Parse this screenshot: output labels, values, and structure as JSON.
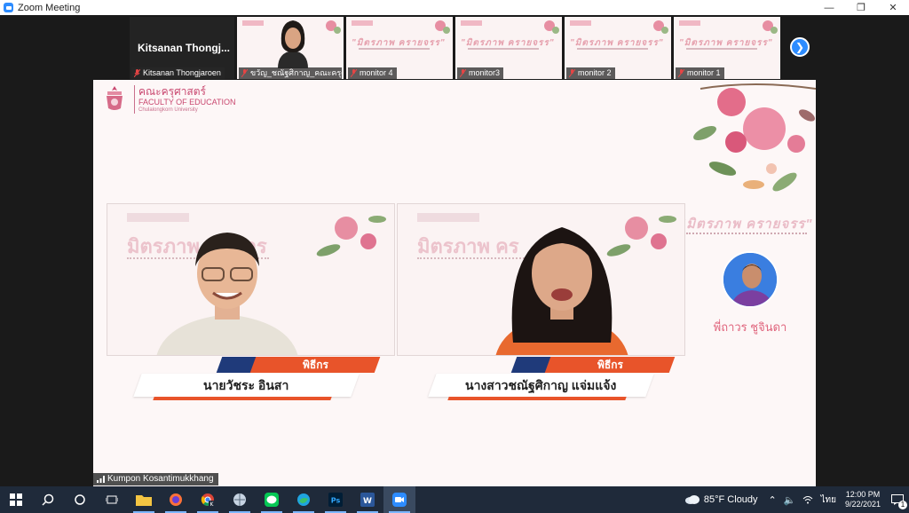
{
  "window": {
    "title": "Zoom Meeting"
  },
  "strip": {
    "self_big_name": "Kitsanan  Thongj...",
    "self_label": "Kitsanan Thongjaroen",
    "thumbs": [
      {
        "label": "ขวัญ_ชณัฐศิกาญ_คณะครุศาสตร์..."
      },
      {
        "label": "monitor 4"
      },
      {
        "label": "monitor3"
      },
      {
        "label": "monitor 2"
      },
      {
        "label": "monitor 1"
      }
    ],
    "thumb_slide_title": "\"มิตรภาพ ครายจรร\""
  },
  "slide": {
    "logo_th": "คณะครุศาสตร์",
    "logo_en": "FACULTY OF EDUCATION",
    "logo_sub": "Chulalongkorn University",
    "side_title": "\"มิตรภาพ ครายจรร\"",
    "side_name": "พี่ถาวร ชูจินดา",
    "pane_title_left": "มิตรภาพ ค...าวร",
    "pane_title_right": "มิตรภาพ คร",
    "speakers": [
      {
        "role": "พิธีกร",
        "name": "นายวัชระ อินสา"
      },
      {
        "role": "พิธีกร",
        "name": "นางสาวชณัฐศิกาญ แจ่มแจ้ง"
      }
    ]
  },
  "active_speaker": "Kumpon Kosantimukkhang",
  "tray": {
    "weather": "85°F  Cloudy",
    "lang": "ไทย",
    "time": "12:00 PM",
    "date": "9/22/2021",
    "notifications": "1"
  },
  "colors": {
    "zoom_blue": "#2d8cff",
    "accent_orange": "#e8542a",
    "navy": "#1f3a7a",
    "pink": "#c9476f"
  }
}
